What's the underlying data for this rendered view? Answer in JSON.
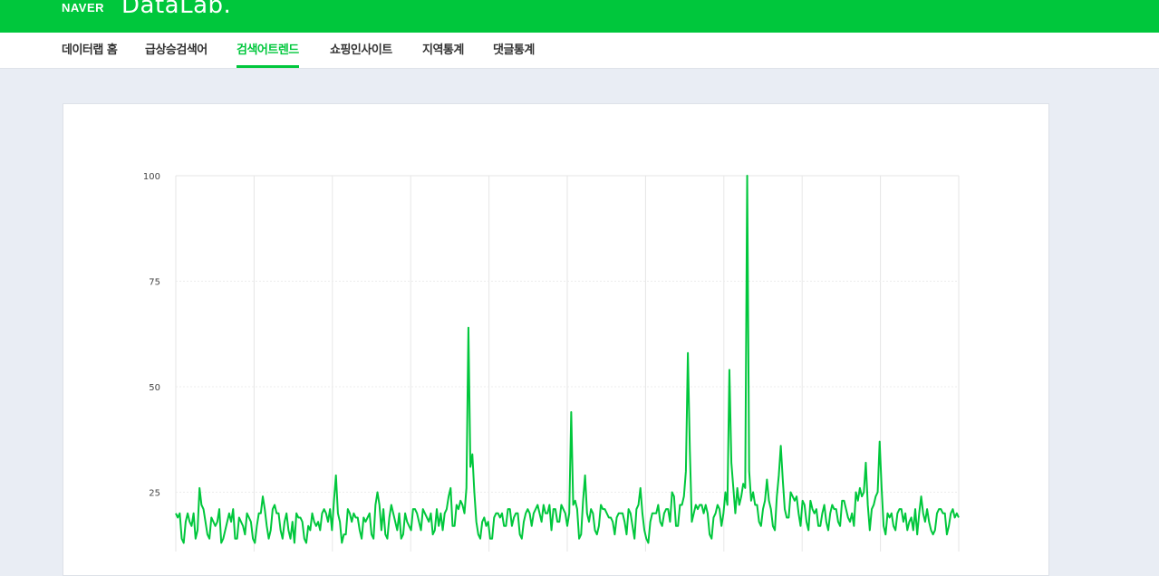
{
  "header": {
    "brand_naver": "NAVER",
    "brand_datalab": "DataLab."
  },
  "nav": {
    "items": [
      {
        "label": "데이터랩 홈"
      },
      {
        "label": "급상승검색어"
      },
      {
        "label": "검색어트렌드"
      },
      {
        "label": "쇼핑인사이트"
      },
      {
        "label": "지역통계"
      },
      {
        "label": "댓글통계"
      }
    ],
    "active_index": 2
  },
  "colors": {
    "brand_green": "#00c73c",
    "background": "#e9edf4"
  },
  "chart_data": {
    "type": "line",
    "ylim": [
      0,
      100
    ],
    "y_ticks": [
      "100",
      "75",
      "50",
      "25"
    ],
    "grid": true,
    "series": [
      {
        "color": "#00c73c",
        "values": [
          20,
          19,
          20,
          14,
          13,
          18,
          20,
          18,
          17,
          20,
          14,
          16,
          26,
          22,
          21,
          18,
          15,
          14,
          19,
          18,
          17,
          18,
          21,
          13,
          14,
          16,
          18,
          20,
          18,
          21,
          14,
          14,
          19,
          18,
          17,
          15,
          20,
          19,
          18,
          14,
          13,
          17,
          20,
          20,
          24,
          21,
          17,
          14,
          16,
          21,
          22,
          20,
          20,
          16,
          14,
          18,
          20,
          16,
          14,
          18,
          13,
          20,
          19,
          19,
          18,
          14,
          13,
          17,
          16,
          20,
          18,
          17,
          18,
          16,
          20,
          21,
          20,
          18,
          21,
          16,
          23,
          29,
          20,
          18,
          13,
          15,
          15,
          21,
          20,
          18,
          20,
          19,
          19,
          16,
          14,
          19,
          18,
          19,
          20,
          15,
          14,
          22,
          25,
          22,
          16,
          21,
          15,
          14,
          19,
          22,
          20,
          18,
          16,
          20,
          14,
          15,
          20,
          18,
          17,
          16,
          21,
          21,
          20,
          18,
          16,
          21,
          20,
          19,
          18,
          20,
          15,
          16,
          21,
          17,
          20,
          16,
          20,
          21,
          24,
          26,
          17,
          17,
          22,
          21,
          23,
          22,
          20,
          26,
          64,
          31,
          34,
          25,
          18,
          15,
          14,
          18,
          19,
          17,
          18,
          14,
          14,
          19,
          20,
          20,
          19,
          20,
          17,
          17,
          21,
          21,
          17,
          19,
          20,
          20,
          15,
          14,
          18,
          20,
          21,
          20,
          17,
          20,
          21,
          22,
          20,
          18,
          22,
          20,
          20,
          22,
          16,
          21,
          21,
          18,
          18,
          22,
          21,
          20,
          17,
          20,
          44,
          22,
          23,
          21,
          14,
          15,
          23,
          29,
          20,
          18,
          21,
          20,
          16,
          15,
          17,
          22,
          21,
          21,
          20,
          19,
          19,
          18,
          15,
          19,
          20,
          20,
          20,
          18,
          15,
          21,
          20,
          17,
          14,
          21,
          22,
          26,
          20,
          16,
          14,
          13,
          18,
          20,
          20,
          20,
          22,
          18,
          17,
          20,
          21,
          21,
          18,
          25,
          24,
          17,
          17,
          22,
          22,
          24,
          30,
          58,
          35,
          18,
          20,
          22,
          21,
          22,
          22,
          20,
          22,
          20,
          15,
          14,
          19,
          20,
          22,
          21,
          17,
          20,
          25,
          22,
          54,
          32,
          26,
          20,
          26,
          22,
          24,
          27,
          26,
          100,
          30,
          23,
          25,
          22,
          22,
          18,
          17,
          21,
          23,
          28,
          23,
          21,
          17,
          16,
          24,
          29,
          36,
          28,
          21,
          19,
          19,
          25,
          24,
          23,
          24,
          20,
          17,
          23,
          22,
          18,
          16,
          23,
          21,
          20,
          21,
          17,
          17,
          20,
          22,
          18,
          16,
          20,
          22,
          21,
          21,
          18,
          17,
          23,
          23,
          21,
          19,
          18,
          20,
          17,
          25,
          23,
          26,
          24,
          25,
          32,
          22,
          16,
          21,
          22,
          24,
          25,
          37,
          26,
          17,
          15,
          20,
          19,
          20,
          17,
          16,
          20,
          21,
          21,
          18,
          20,
          16,
          18,
          19,
          16,
          21,
          15,
          20,
          24,
          20,
          18,
          21,
          18,
          16,
          15,
          16,
          20,
          21,
          21,
          20,
          20,
          15,
          17,
          20,
          21,
          19,
          20,
          19
        ]
      }
    ]
  }
}
